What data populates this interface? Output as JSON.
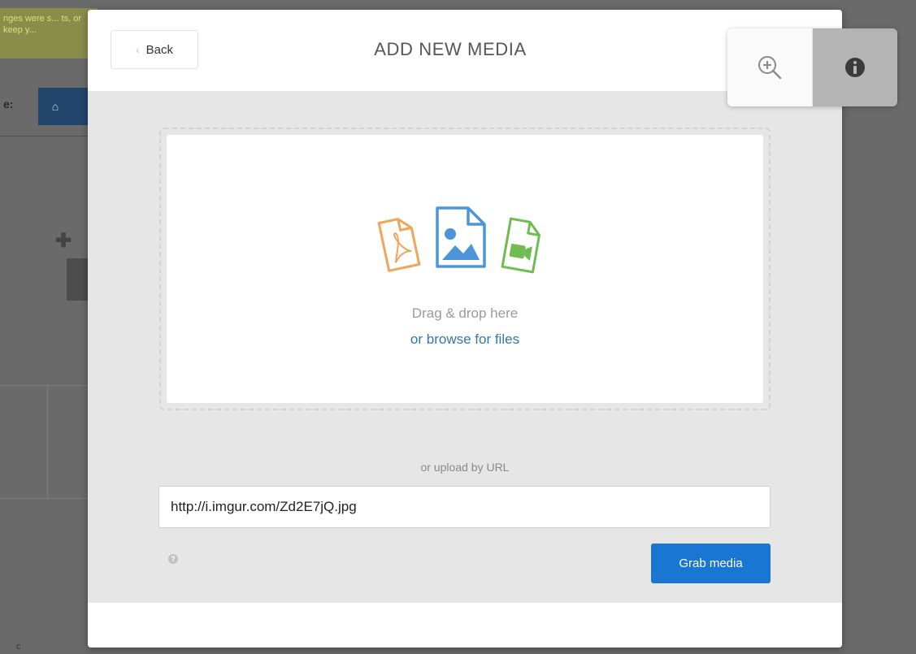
{
  "background": {
    "notice_text": "nges were s... ts, or keep y...",
    "page_label": "e:",
    "home_icon": "home-icon",
    "plus_icon": "move-icon",
    "bottom_text": "c"
  },
  "modal": {
    "title": "ADD NEW MEDIA",
    "back_label": "Back",
    "dropzone": {
      "drag_text": "Drag & drop here",
      "browse_text": "or browse for files",
      "icons": [
        "pdf-file-icon",
        "image-file-icon",
        "video-file-icon"
      ]
    },
    "url_label": "or upload by URL",
    "url_value": "http://i.imgur.com/Zd2E7jQ.jpg",
    "grab_label": "Grab media"
  },
  "viewer_toolbar": {
    "zoom_icon": "zoom-in-icon",
    "info_icon": "info-icon"
  },
  "colors": {
    "accent": "#1976d2",
    "link": "#3775ad",
    "pdf_icon": "#f0a55a",
    "image_icon": "#4d95d8",
    "video_icon": "#6fbd52",
    "overlay": "#6a6a6a"
  }
}
